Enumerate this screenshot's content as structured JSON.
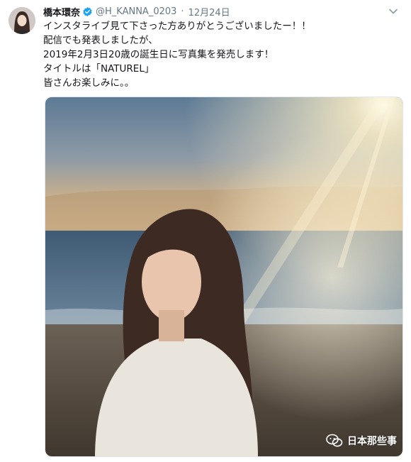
{
  "tweet": {
    "display_name": "橋本環奈",
    "handle": "@H_KANNA_0203",
    "separator": "·",
    "timestamp": "12月24日",
    "text_lines": [
      "インスタライブ見て下さった方ありがとうございましたー！！",
      "配信でも発表しましたが、",
      "2019年2月3日20歳の誕生日に写真集を発売します！",
      "タイトルは「NATUREL」",
      "皆さんお楽しみに。。"
    ]
  },
  "watermark": {
    "text": "日本那些事"
  },
  "icons": {
    "avatar": "profile-avatar",
    "verified": "verified-badge-icon",
    "menu": "chevron-down-icon",
    "watermark": "wechat-icon"
  },
  "colors": {
    "verified": "#1da1f2",
    "secondary_text": "#657786",
    "primary_text": "#14171a"
  }
}
